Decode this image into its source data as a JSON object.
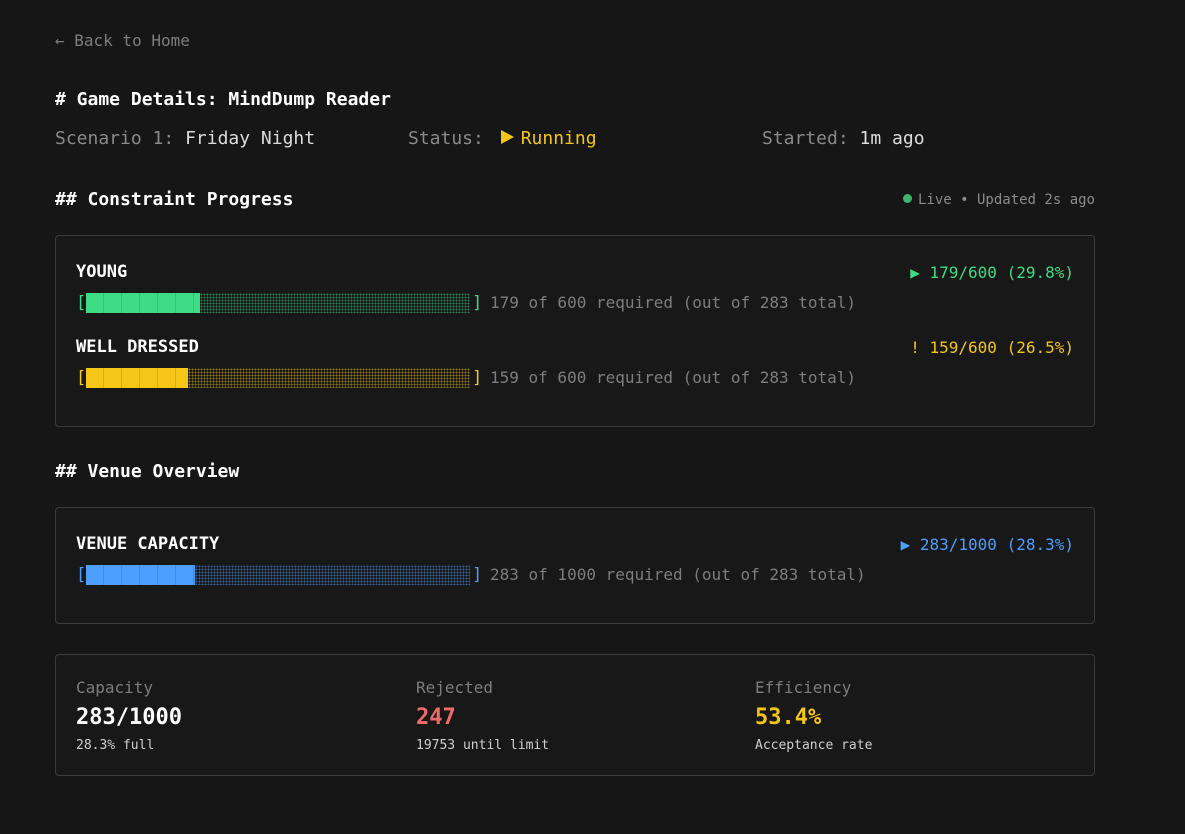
{
  "nav": {
    "back_label": "← Back to Home"
  },
  "header": {
    "title": "# Game Details: MindDump Reader",
    "scenario_label": "Scenario 1:",
    "scenario_value": "Friday Night",
    "status_label": "Status:",
    "status_icon": "play-icon",
    "status_value": "Running",
    "started_label": "Started:",
    "started_value": "1m ago"
  },
  "constraints": {
    "title": "## Constraint Progress",
    "live_label": "Live • Updated 2s ago",
    "items": [
      {
        "name": "YOUNG",
        "stat_icon": "▶",
        "stat": "179/600 (29.8%)",
        "progress": 0.298,
        "note": "179 of 600 required (out of 283 total)",
        "color": "#3ddc84"
      },
      {
        "name": "WELL DRESSED",
        "stat_icon": "!",
        "stat": "159/600 (26.5%)",
        "progress": 0.265,
        "note": "159 of 600 required (out of 283 total)",
        "color": "#f5c518"
      }
    ]
  },
  "venue": {
    "title": "## Venue Overview",
    "capacity_name": "VENUE CAPACITY",
    "stat_icon": "▶",
    "stat": "283/1000 (28.3%)",
    "progress": 0.283,
    "note": "283 of 1000 required (out of 283 total)",
    "color": "#4d9eff"
  },
  "stats": {
    "capacity_label": "Capacity",
    "capacity_value": "283/1000",
    "capacity_sub": "28.3% full",
    "rejected_label": "Rejected",
    "rejected_value": "247",
    "rejected_sub": "19753 until limit",
    "efficiency_label": "Efficiency",
    "efficiency_value": "53.4%",
    "efficiency_sub": "Acceptance rate",
    "colors": {
      "capacity": "#ffffff",
      "rejected": "#f26b6b",
      "efficiency": "#f5c518"
    }
  }
}
